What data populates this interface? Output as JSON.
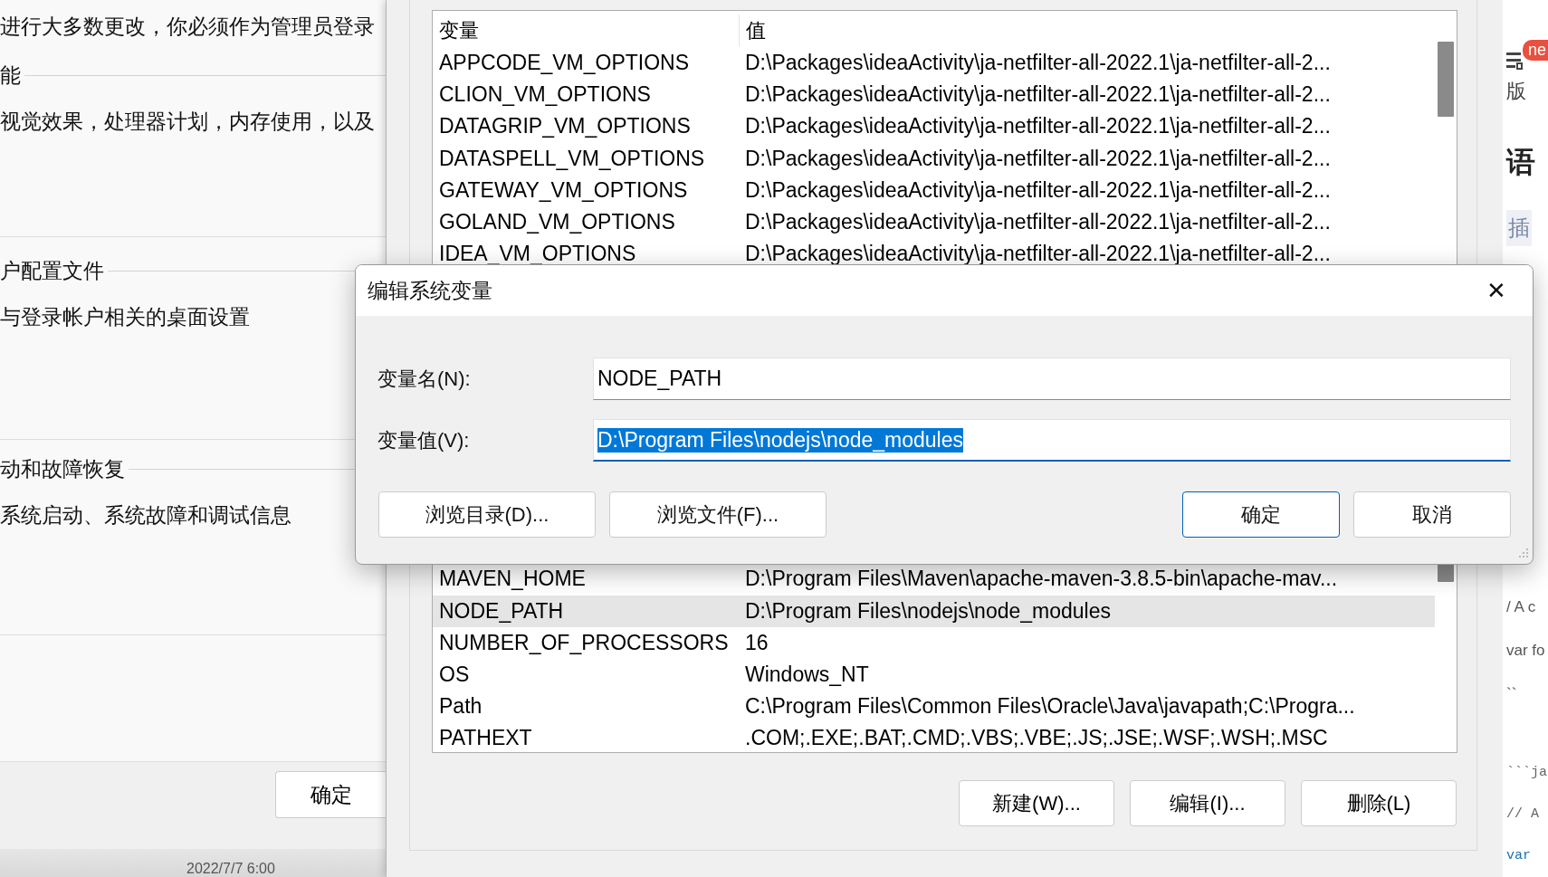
{
  "background_panel": {
    "intro": "进行大多数更改，你必须作为管理员登录",
    "sections": [
      {
        "heading": "能",
        "description": "视觉效果，处理器计划，内存使用，以及"
      },
      {
        "heading": "户配置文件",
        "description": "与登录帐户相关的桌面设置"
      },
      {
        "heading": "动和故障恢复",
        "description": "系统启动、系统故障和调试信息"
      }
    ],
    "ok_button": "确定",
    "timestamp": "2022/7/7 6:00"
  },
  "variables_window": {
    "columns": [
      "变量",
      "值"
    ],
    "rows_above": [
      {
        "name": "APPCODE_VM_OPTIONS",
        "value": "D:\\Packages\\ideaActivity\\ja-netfilter-all-2022.1\\ja-netfilter-all-2...",
        "selected": false
      },
      {
        "name": "CLION_VM_OPTIONS",
        "value": "D:\\Packages\\ideaActivity\\ja-netfilter-all-2022.1\\ja-netfilter-all-2...",
        "selected": false
      },
      {
        "name": "DATAGRIP_VM_OPTIONS",
        "value": "D:\\Packages\\ideaActivity\\ja-netfilter-all-2022.1\\ja-netfilter-all-2...",
        "selected": false
      },
      {
        "name": "DATASPELL_VM_OPTIONS",
        "value": "D:\\Packages\\ideaActivity\\ja-netfilter-all-2022.1\\ja-netfilter-all-2...",
        "selected": false
      },
      {
        "name": "GATEWAY_VM_OPTIONS",
        "value": "D:\\Packages\\ideaActivity\\ja-netfilter-all-2022.1\\ja-netfilter-all-2...",
        "selected": false
      },
      {
        "name": "GOLAND_VM_OPTIONS",
        "value": "D:\\Packages\\ideaActivity\\ja-netfilter-all-2022.1\\ja-netfilter-all-2...",
        "selected": false
      },
      {
        "name": "IDEA_VM_OPTIONS",
        "value": "D:\\Packages\\ideaActivity\\ja-netfilter-all-2022.1\\ja-netfilter-all-2...",
        "selected": false
      }
    ],
    "rows_below": [
      {
        "name": "MAVEN_HOME",
        "value": "D:\\Program Files\\Maven\\apache-maven-3.8.5-bin\\apache-mav...",
        "selected": false
      },
      {
        "name": "NODE_PATH",
        "value": "D:\\Program Files\\nodejs\\node_modules",
        "selected": true
      },
      {
        "name": "NUMBER_OF_PROCESSORS",
        "value": "16",
        "selected": false
      },
      {
        "name": "OS",
        "value": "Windows_NT",
        "selected": false
      },
      {
        "name": "Path",
        "value": "C:\\Program Files\\Common Files\\Oracle\\Java\\javapath;C:\\Progra...",
        "selected": false
      },
      {
        "name": "PATHEXT",
        "value": ".COM;.EXE;.BAT;.CMD;.VBS;.VBE;.JS;.JSE;.WSF;.WSH;.MSC",
        "selected": false
      }
    ],
    "buttons": [
      "新建(W)...",
      "编辑(I)...",
      "删除(L)"
    ]
  },
  "edit_dialog": {
    "title": "编辑系统变量",
    "close": "✕",
    "fields": [
      {
        "label": "变量名(N):",
        "value": "NODE_PATH",
        "focused": false
      },
      {
        "label": "变量值(V):",
        "value": "D:\\Program Files\\nodejs\\node_modules",
        "focused": true
      }
    ],
    "buttons": [
      {
        "label": "浏览目录(D)...",
        "default": false
      },
      {
        "label": "浏览文件(F)...",
        "default": false
      },
      {
        "label": "确定",
        "default": true
      },
      {
        "label": "取消",
        "default": false
      }
    ]
  },
  "side_page": {
    "badge": "ne",
    "items": [
      {
        "kind": "label",
        "text": "版"
      },
      {
        "kind": "heading",
        "text": "语"
      },
      {
        "kind": "chip",
        "text": "插"
      },
      {
        "kind": "code",
        "text": "/ A c"
      },
      {
        "kind": "code",
        "text": "var fo"
      },
      {
        "kind": "code",
        "text": "``"
      },
      {
        "kind": "mono",
        "text": "```ja"
      },
      {
        "kind": "mono",
        "text": "// A"
      },
      {
        "kind": "keyword",
        "text": "var"
      }
    ]
  }
}
